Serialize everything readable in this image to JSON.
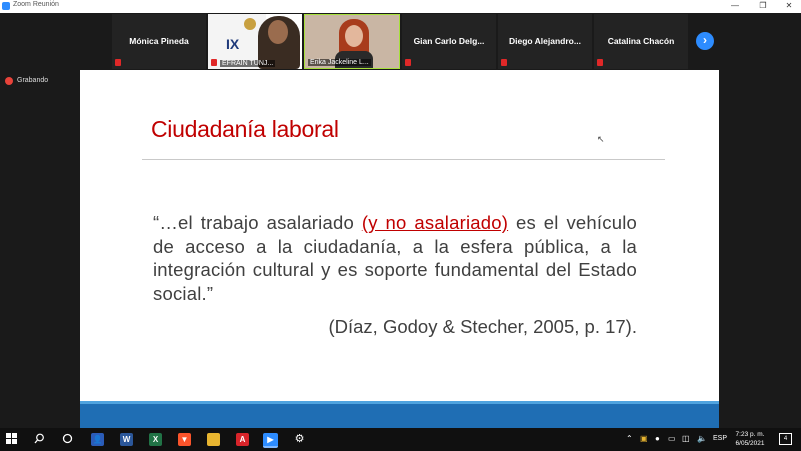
{
  "window": {
    "title": "Zoom Reunión",
    "minimize": "—",
    "restore": "❐",
    "close": "✕"
  },
  "participants": [
    {
      "name": "Mónica Pineda",
      "muted": true
    },
    {
      "name": "EFRAIN TUNJ...",
      "video": true,
      "muted": true,
      "logo_text": "IX"
    },
    {
      "name": "Erika Jackeline L...",
      "video": true,
      "muted": false,
      "active_speaker": true
    },
    {
      "name": "Gian Carlo Delg...",
      "muted": true
    },
    {
      "name": "Diego Alejandro...",
      "muted": true
    },
    {
      "name": "Catalina Chacón",
      "muted": true
    }
  ],
  "next_page_icon": "›",
  "recording": {
    "label": "Grabando",
    "color": "#e8433a"
  },
  "slide": {
    "title": "Ciudadanía laboral",
    "quote_before": "“…el trabajo asalariado ",
    "quote_highlight": "(y no asalariado)",
    "quote_after": " es el vehículo de acceso a la ciudadanía, a la esfera pública, a la integración cultural y es soporte fundamental del Estado social.”",
    "citation": "(Díaz, Godoy & Stecher, 2005, p. 17).",
    "accent_color": "#c00000",
    "footer_color": "#1f6eb4"
  },
  "taskbar": {
    "start_icon": "windows-logo-icon",
    "search_icon": "search-icon",
    "apps": [
      "cortana-icon",
      "people-icon",
      "word-icon",
      "excel-icon",
      "brave-icon",
      "file-explorer-icon",
      "acrobat-icon",
      "zoom-icon",
      "settings-icon"
    ],
    "language": "ESP",
    "time": "7:23 p. m.",
    "date": "6/05/2021",
    "notification_count": "4"
  }
}
